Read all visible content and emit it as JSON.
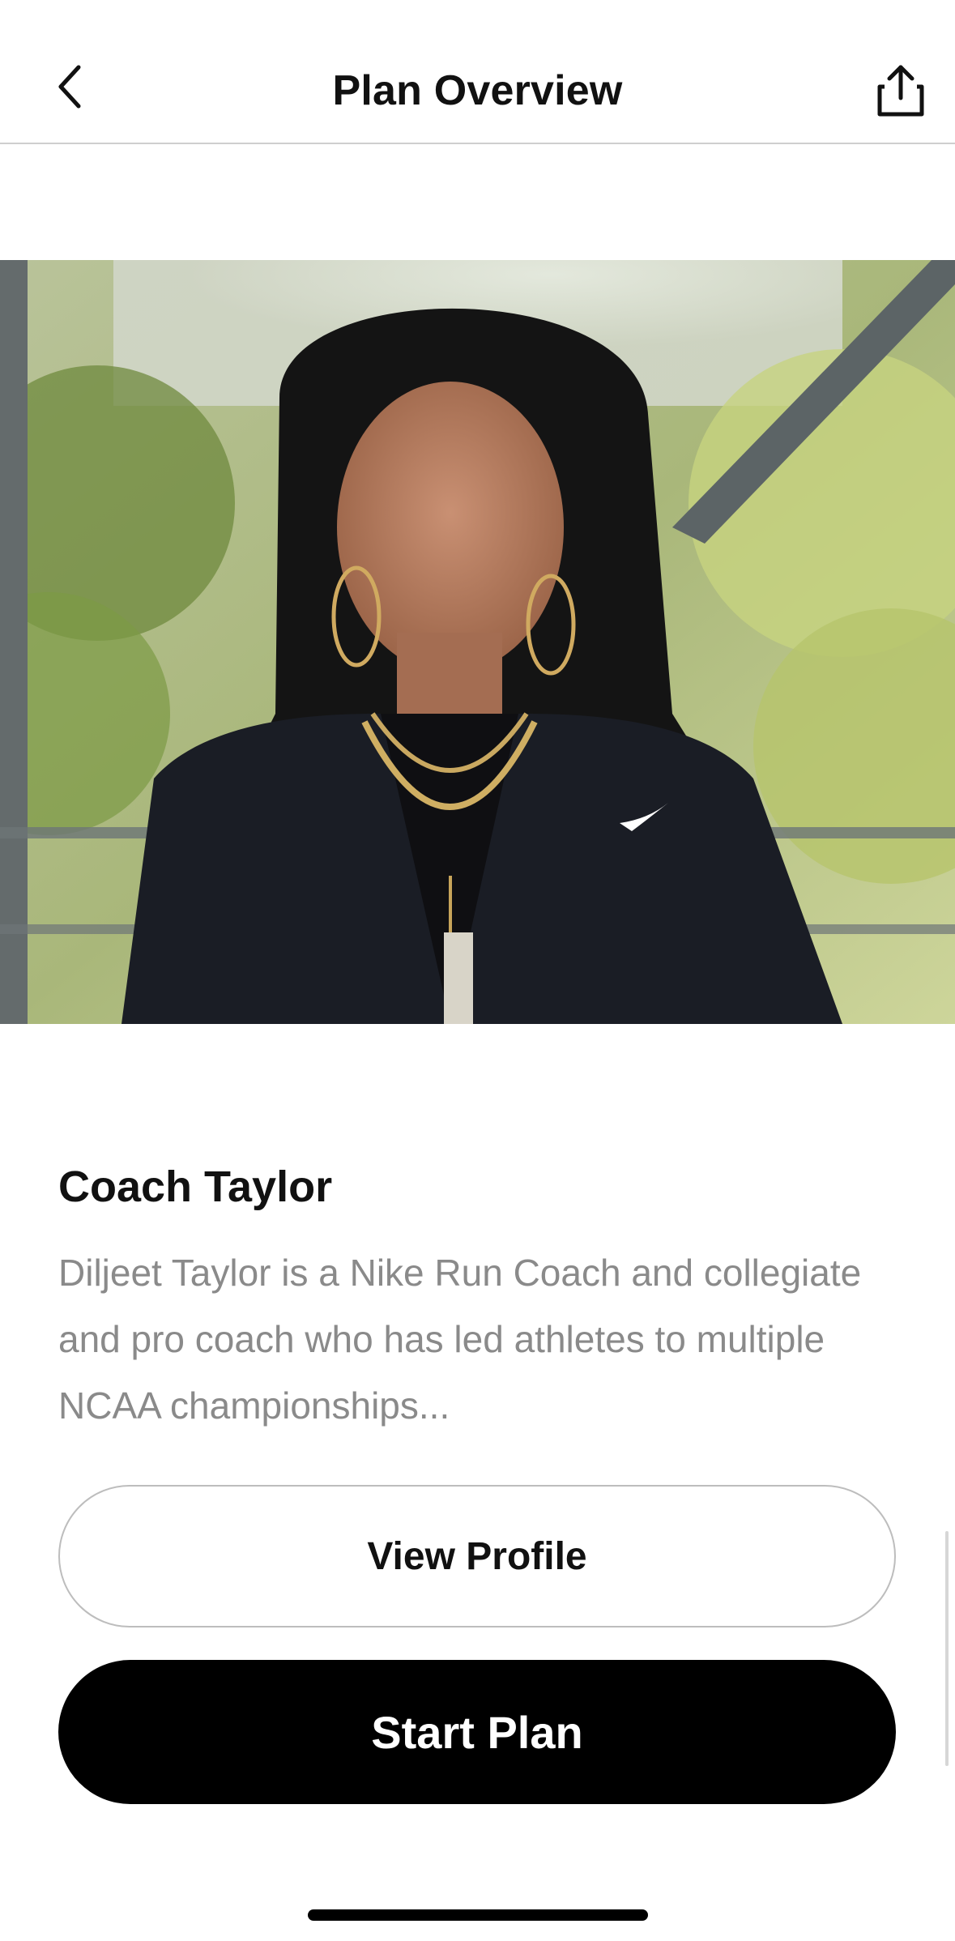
{
  "header": {
    "title": "Plan Overview",
    "back_icon": "chevron-left-icon",
    "share_icon": "share-icon"
  },
  "hero": {
    "image": "coach-portrait-photo",
    "description_note": "photo of coach in dark jacket outdoors"
  },
  "coach": {
    "name": "Coach Taylor",
    "bio": "Diljeet Taylor is a Nike Run Coach and collegiate and pro coach who has led athletes to multiple NCAA championships..."
  },
  "buttons": {
    "view_profile": "View Profile",
    "start_plan": "Start Plan"
  },
  "colors": {
    "primary": "#000000",
    "muted_text": "#8a8a8a",
    "outline": "#bdbdbd"
  }
}
